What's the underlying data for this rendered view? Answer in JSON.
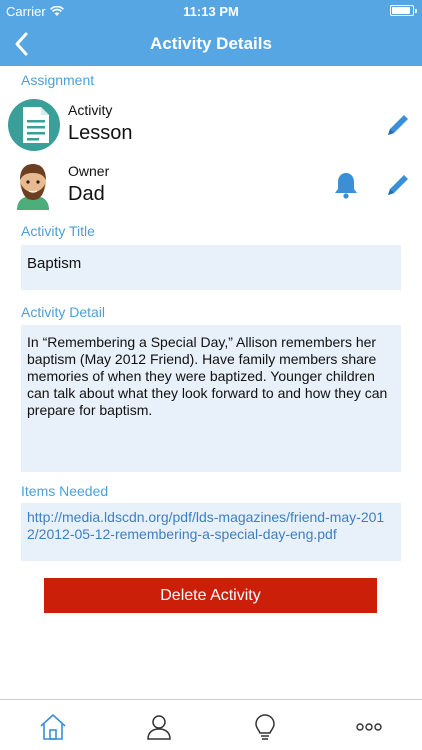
{
  "status_bar": {
    "carrier": "Carrier",
    "time": "11:13 PM",
    "battery_level": 0.9
  },
  "nav": {
    "title": "Activity Details",
    "back_icon": "chevron-left-icon"
  },
  "assignment": {
    "section_label": "Assignment",
    "activity": {
      "label": "Activity",
      "value": "Lesson",
      "icon": "document-icon"
    },
    "owner": {
      "label": "Owner",
      "value": "Dad",
      "icon": "avatar"
    }
  },
  "activity_title": {
    "label": "Activity Title",
    "value": "Baptism"
  },
  "activity_detail": {
    "label": "Activity Detail",
    "value": "In “Remembering a Special Day,” Allison remembers her baptism (May 2012 Friend). Have family members share memories of when they were baptized. Younger children can talk about what they look forward to and how they can prepare for baptism."
  },
  "items_needed": {
    "label": "Items Needed",
    "value": "http://media.ldscdn.org/pdf/lds-magazines/friend-may-2012/2012-05-12-remembering-a-special-day-eng.pdf"
  },
  "delete_label": "Delete Activity",
  "tabs": [
    "home-icon",
    "person-icon",
    "lightbulb-icon",
    "more-icon"
  ],
  "colors": {
    "accent": "#56a6e3",
    "field_bg": "#e8f0fa",
    "delete": "#cc1f0a",
    "teal": "#3a9e99"
  }
}
